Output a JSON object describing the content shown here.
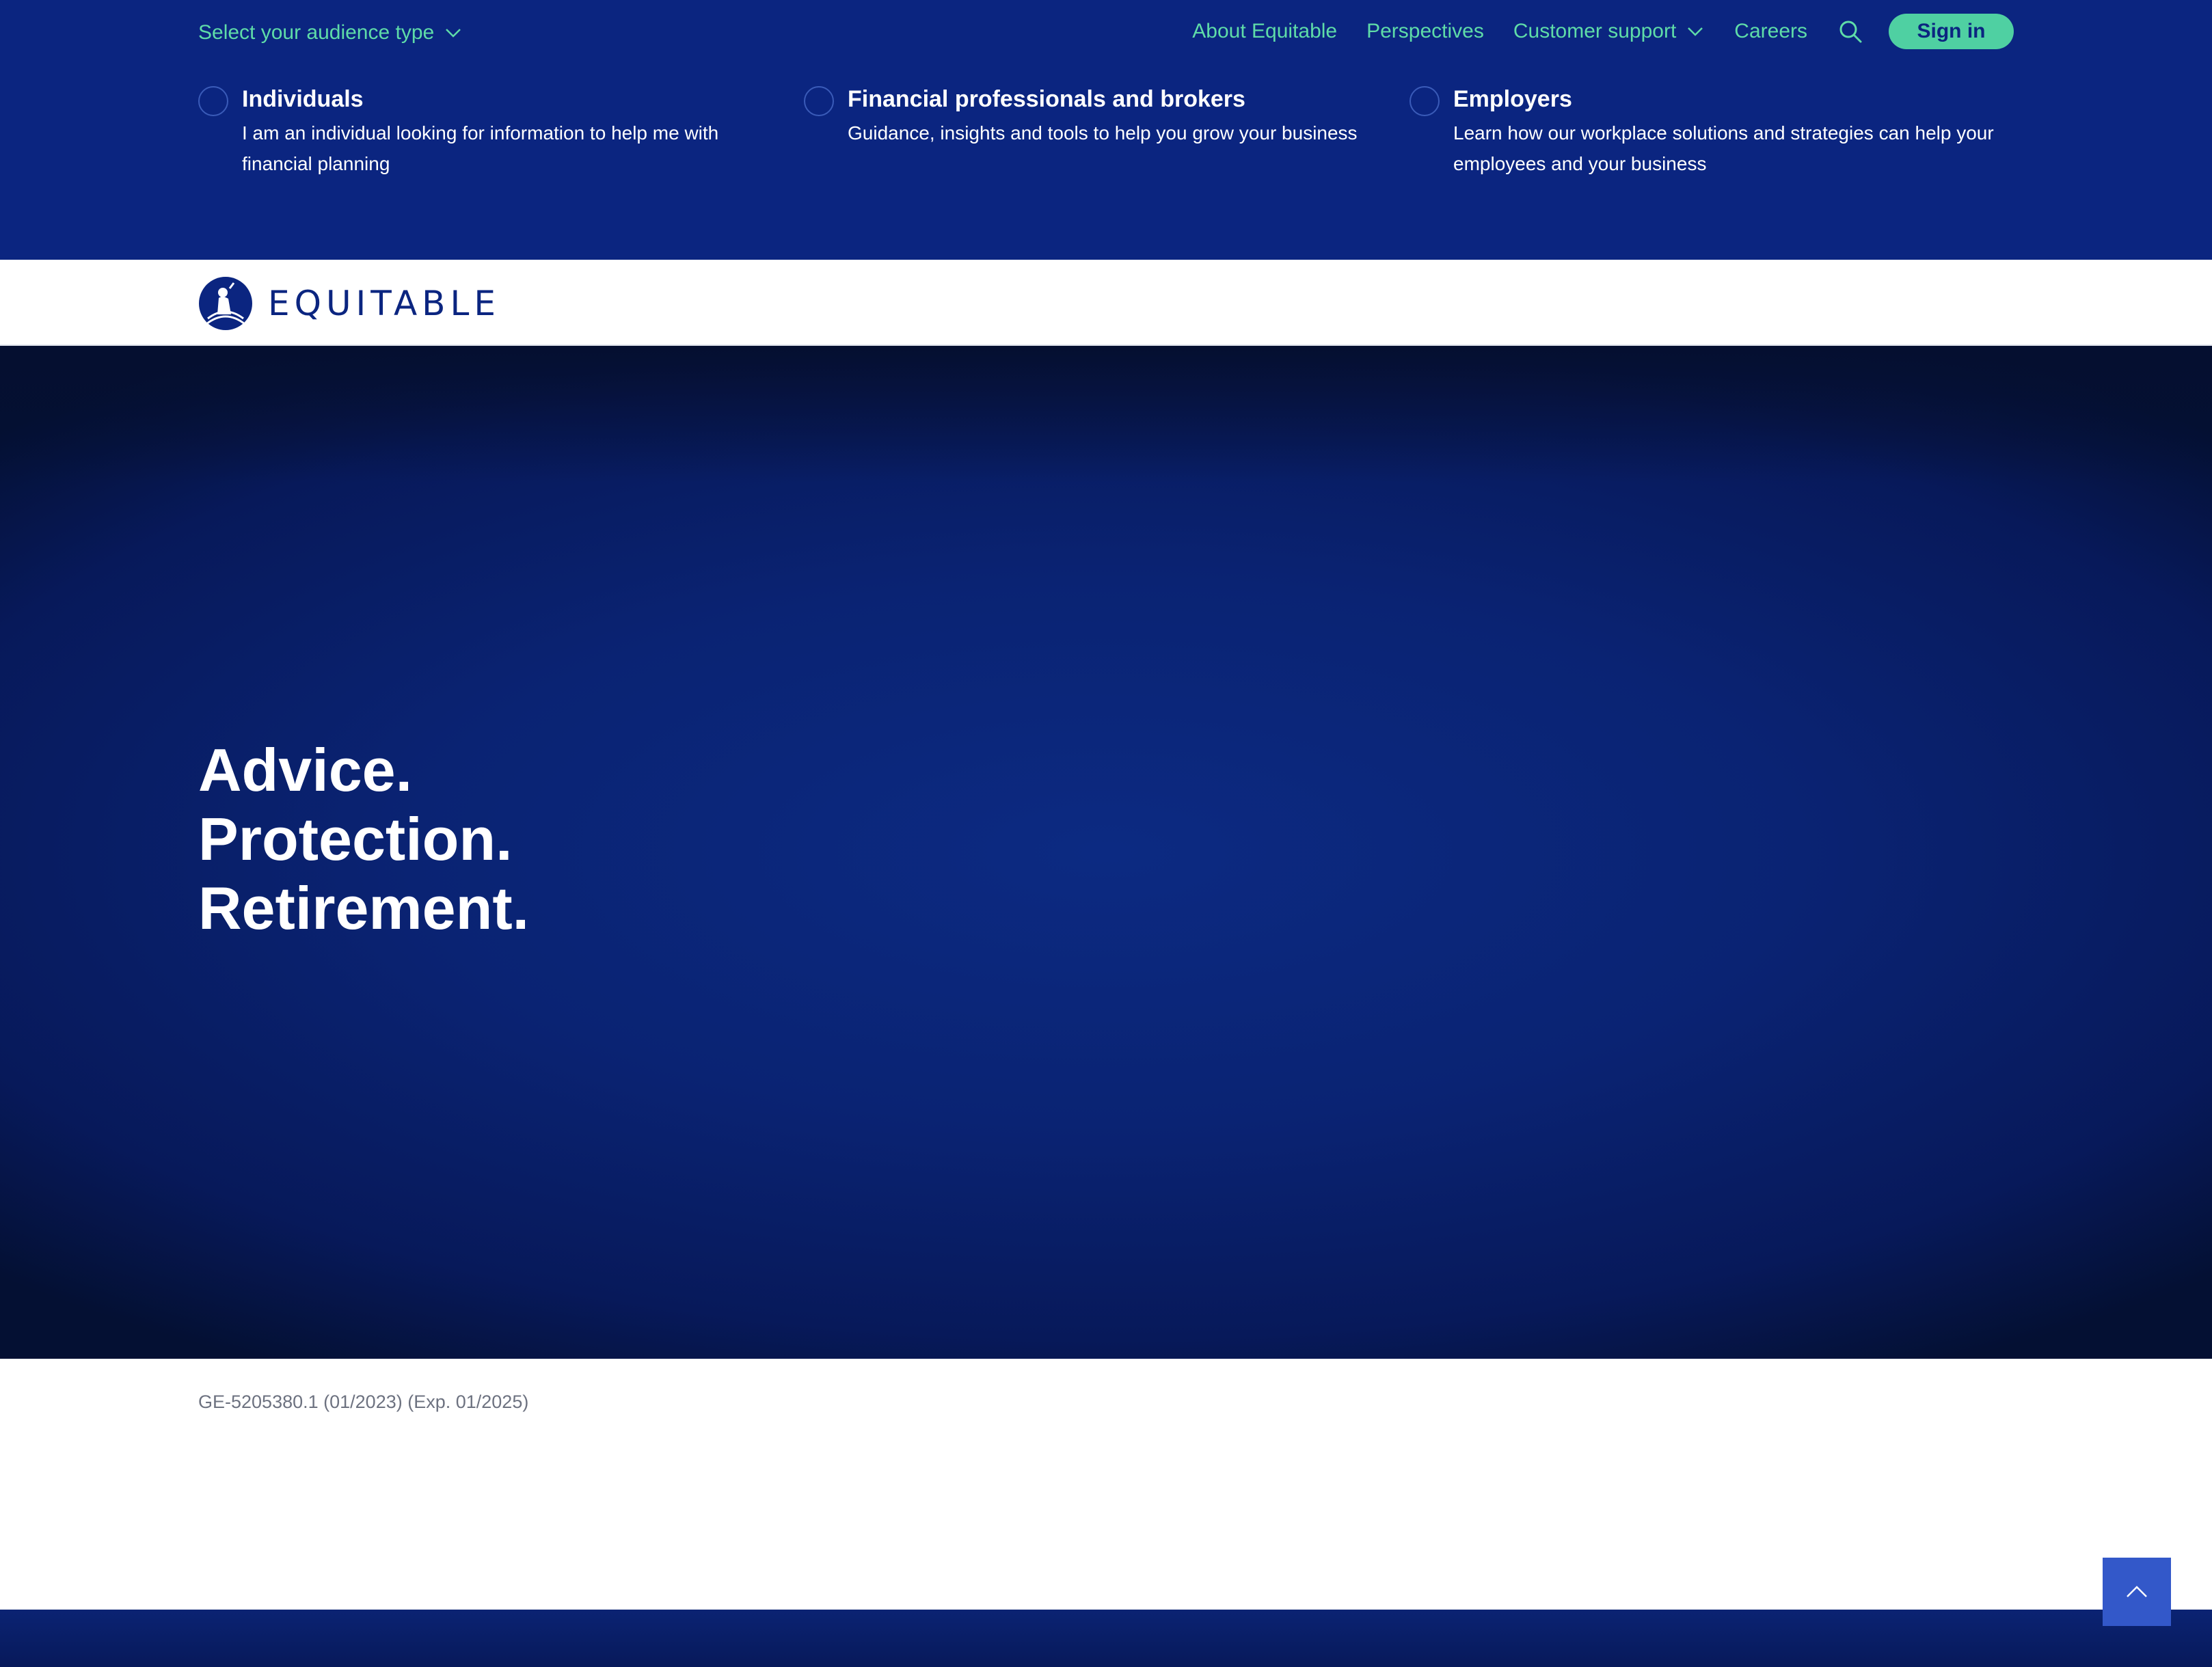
{
  "colors": {
    "brand_navy": "#0b2580",
    "accent_green": "#5fdca8",
    "signin_bg": "#4fd0a2",
    "hero_deep": "#041033",
    "legal_gray": "#6d7280"
  },
  "utility_nav": {
    "audience_toggle_label": "Select your audience type",
    "audience_toggle_icon": "chevron-down-icon",
    "links": {
      "about": "About Equitable",
      "perspectives": "Perspectives",
      "customer_support": "Customer support",
      "careers": "Careers"
    },
    "customer_support_icon": "chevron-down-icon",
    "search_icon": "search-icon",
    "signin_label": "Sign in"
  },
  "audience_options": [
    {
      "title": "Individuals",
      "description": "I am an individual looking for information to help me with financial planning"
    },
    {
      "title": "Financial professionals and brokers",
      "description": "Guidance, insights and tools to help you grow your business"
    },
    {
      "title": "Employers",
      "description": "Learn how our workplace solutions and strategies can help your employees and your business"
    }
  ],
  "brand": {
    "logo_text": "EQUITABLE",
    "logo_icon": "equitable-emblem-icon"
  },
  "hero": {
    "line1": "Advice.",
    "line2": "Protection.",
    "line3": "Retirement."
  },
  "legal": {
    "code": "GE-5205380.1 (01/2023) (Exp. 01/2025)"
  },
  "back_to_top_icon": "chevron-up-icon"
}
